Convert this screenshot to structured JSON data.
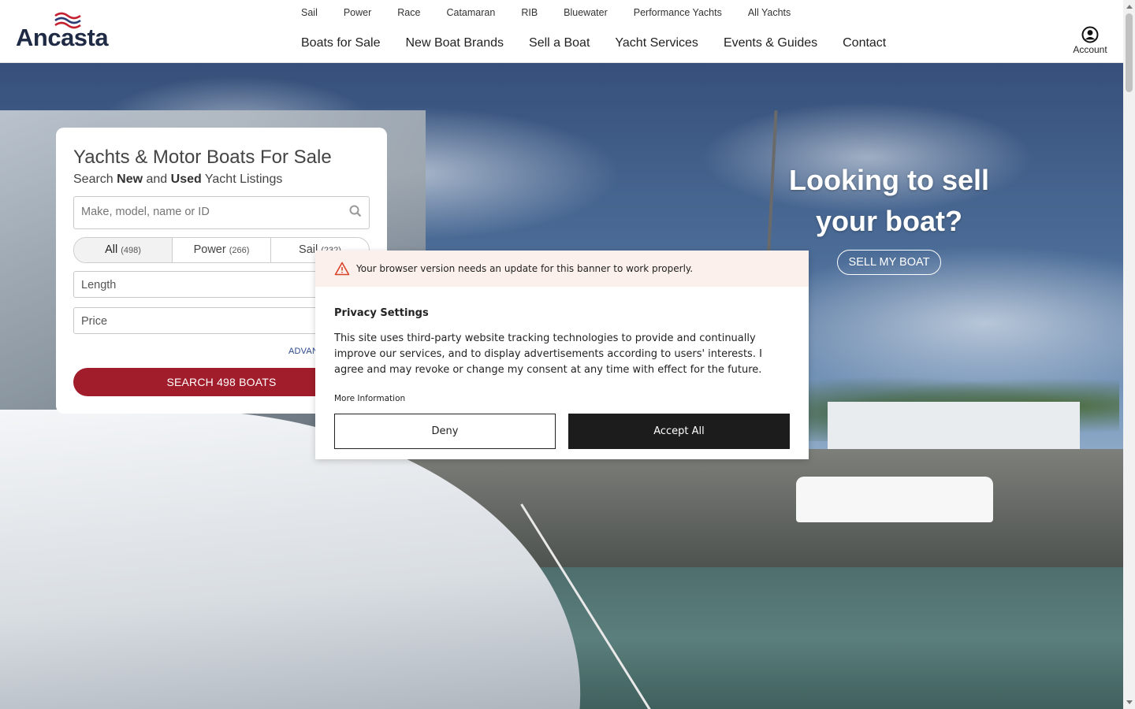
{
  "header": {
    "logo_text": "Ancasta",
    "subnav": [
      "Sail",
      "Power",
      "Race",
      "Catamaran",
      "RIB",
      "Bluewater",
      "Performance Yachts",
      "All Yachts"
    ],
    "mainnav": [
      "Boats for Sale",
      "New Boat Brands",
      "Sell a Boat",
      "Yacht Services",
      "Events & Guides",
      "Contact"
    ],
    "account_label": "Account"
  },
  "search_card": {
    "title": "Yachts & Motor Boats For Sale",
    "subtitle_pre": "Search ",
    "subtitle_new": "New",
    "subtitle_mid": " and ",
    "subtitle_used": "Used",
    "subtitle_post": " Yacht Listings",
    "search_placeholder": "Make, model, name or ID",
    "segments": [
      {
        "label": "All",
        "count": "(498)"
      },
      {
        "label": "Power",
        "count": "(266)"
      },
      {
        "label": "Sail",
        "count": "(232)"
      }
    ],
    "length_label": "Length",
    "price_label": "Price",
    "advanced_label": "ADVANCED SEARCH",
    "search_button": "SEARCH 498 BOATS"
  },
  "sell": {
    "heading_line1": "Looking to sell",
    "heading_line2": "your boat?",
    "button": "SELL MY BOAT"
  },
  "privacy": {
    "warning": "Your browser version needs an update for this banner to work properly.",
    "title": "Privacy Settings",
    "body": "This site uses third-party website tracking technologies to provide and continually improve our services, and to display advertisements according to users' interests. I agree and may revoke or change my consent at any time with effect for the future.",
    "more_info": "More Information",
    "deny": "Deny",
    "accept": "Accept All"
  },
  "colors": {
    "brand_red": "#a11d2b",
    "logo_navy": "#1f2a44",
    "accept_bg": "#1c1c1c",
    "warning_bg": "#fbf0eb"
  }
}
